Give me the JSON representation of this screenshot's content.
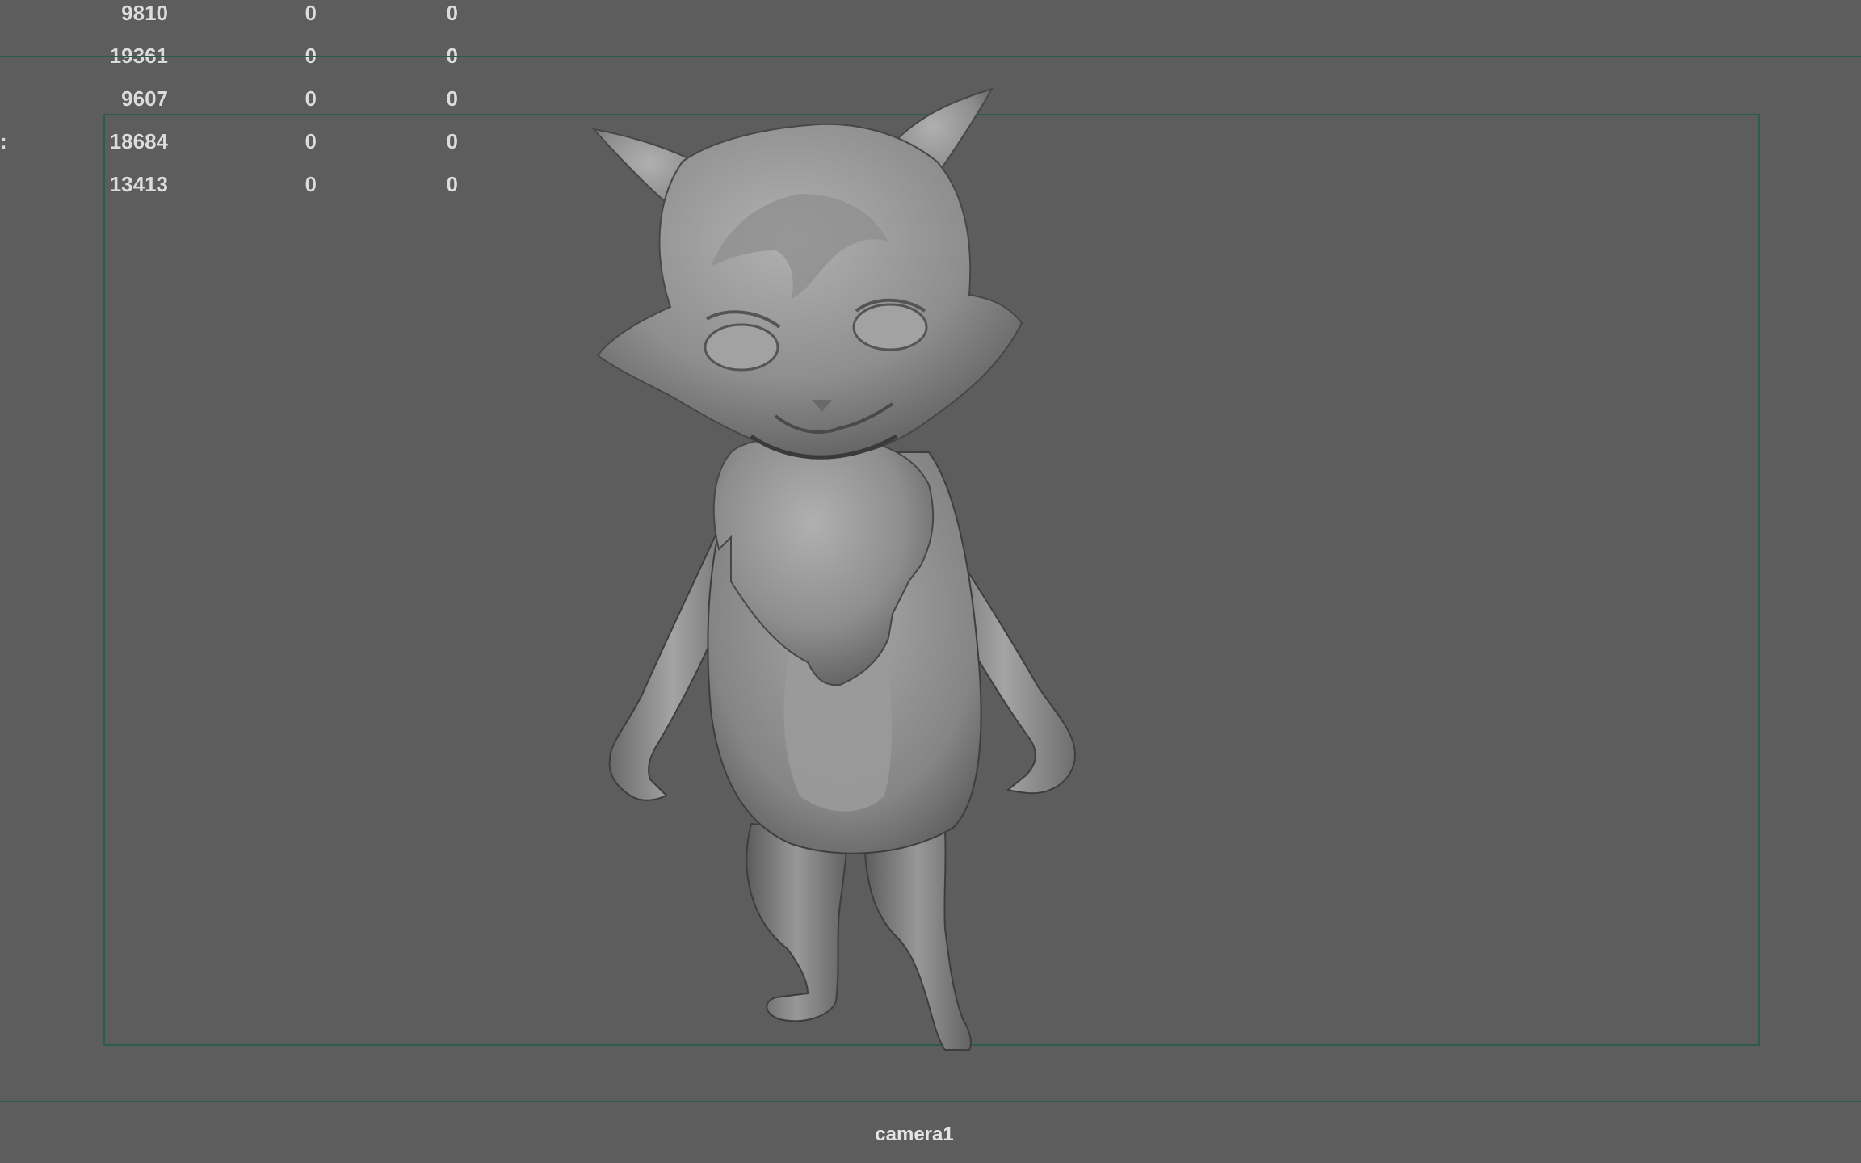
{
  "hud": {
    "rows": [
      {
        "value": "9810",
        "col2": "0",
        "col3": "0"
      },
      {
        "value": "19361",
        "col2": "0",
        "col3": "0"
      },
      {
        "value": "9607",
        "col2": "0",
        "col3": "0"
      },
      {
        "value": "18684",
        "col2": "0",
        "col3": "0"
      },
      {
        "value": "13413",
        "col2": "0",
        "col3": "0"
      }
    ],
    "colon": ":"
  },
  "viewport": {
    "camera_label": "camera1",
    "background_color": "#5d5d5d",
    "gate_color": "#2c5c4c"
  },
  "model": {
    "description_icon": "fox-character-model"
  }
}
